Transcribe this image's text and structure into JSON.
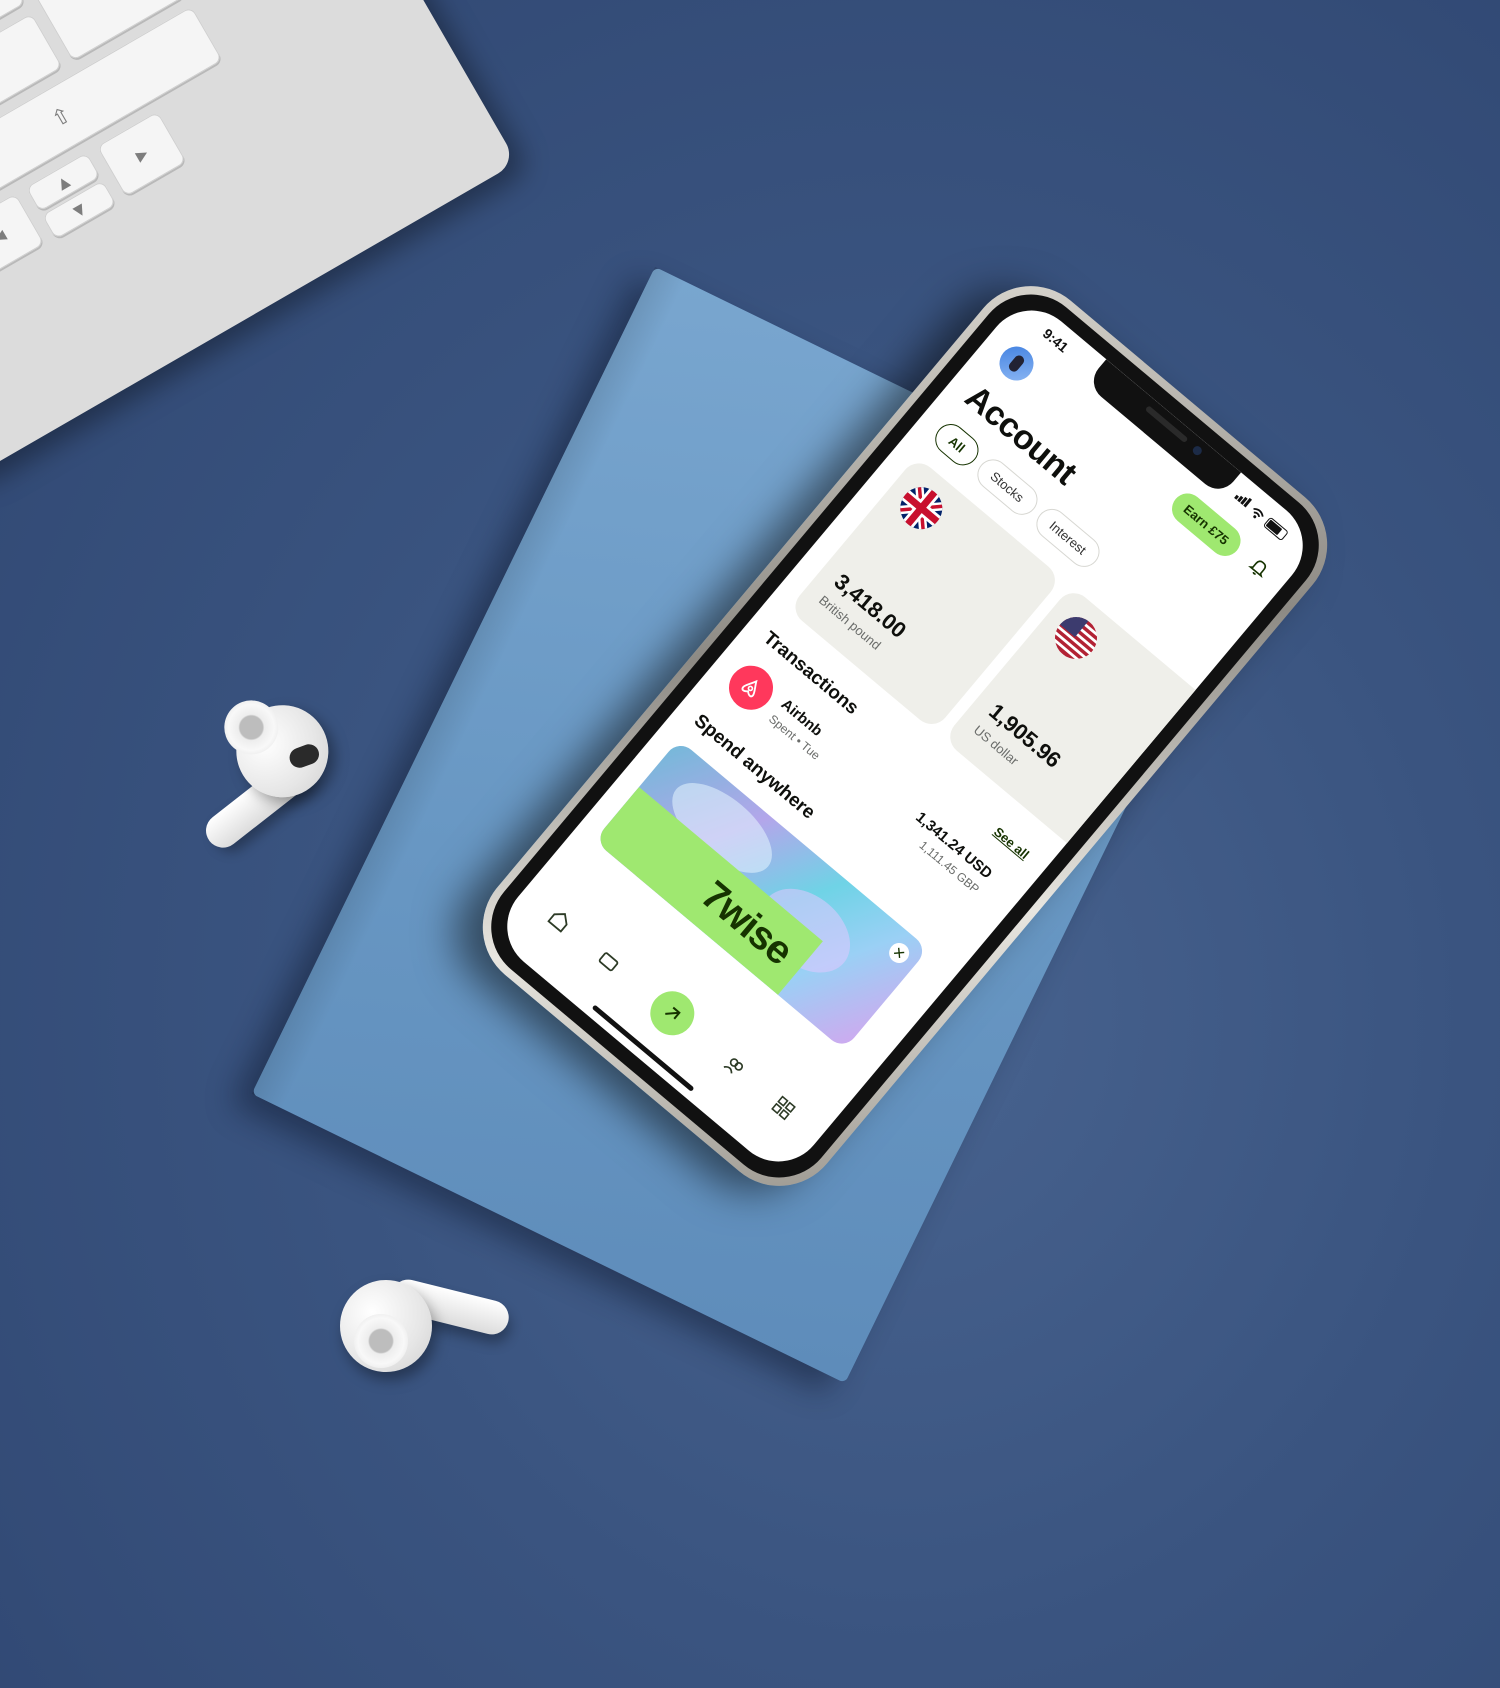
{
  "status_bar": {
    "time": "9:41"
  },
  "header": {
    "earn_label": "Earn £75"
  },
  "page": {
    "title": "Account"
  },
  "filters": [
    {
      "label": "All",
      "active": true
    },
    {
      "label": "Stocks",
      "active": false
    },
    {
      "label": "Interest",
      "active": false
    }
  ],
  "balances": [
    {
      "amount": "3,418.00",
      "currency": "British pound",
      "flag_icon": "uk-flag-icon"
    },
    {
      "amount": "1,905.96",
      "currency": "US dollar",
      "flag_icon": "us-flag-icon"
    }
  ],
  "transactions": {
    "title": "Transactions",
    "see_all": "See all",
    "items": [
      {
        "name": "Airbnb",
        "meta": "Spent • Tue",
        "amount": "1,341.24 USD",
        "sub_amount": "1,111.45 GBP",
        "icon": "airbnb-logo-icon"
      }
    ]
  },
  "promo": {
    "title": "Spend anywhere",
    "brand": "7wise"
  },
  "nav": [
    {
      "icon": "home-icon"
    },
    {
      "icon": "card-icon"
    },
    {
      "icon": "send-arrow-icon"
    },
    {
      "icon": "recipients-icon"
    },
    {
      "icon": "grid-icon"
    }
  ],
  "colors": {
    "accent": "#9fe870",
    "forest": "#163300",
    "airbnb": "#ff385c",
    "background": "#3a5480",
    "notebook": "#6897c3"
  }
}
